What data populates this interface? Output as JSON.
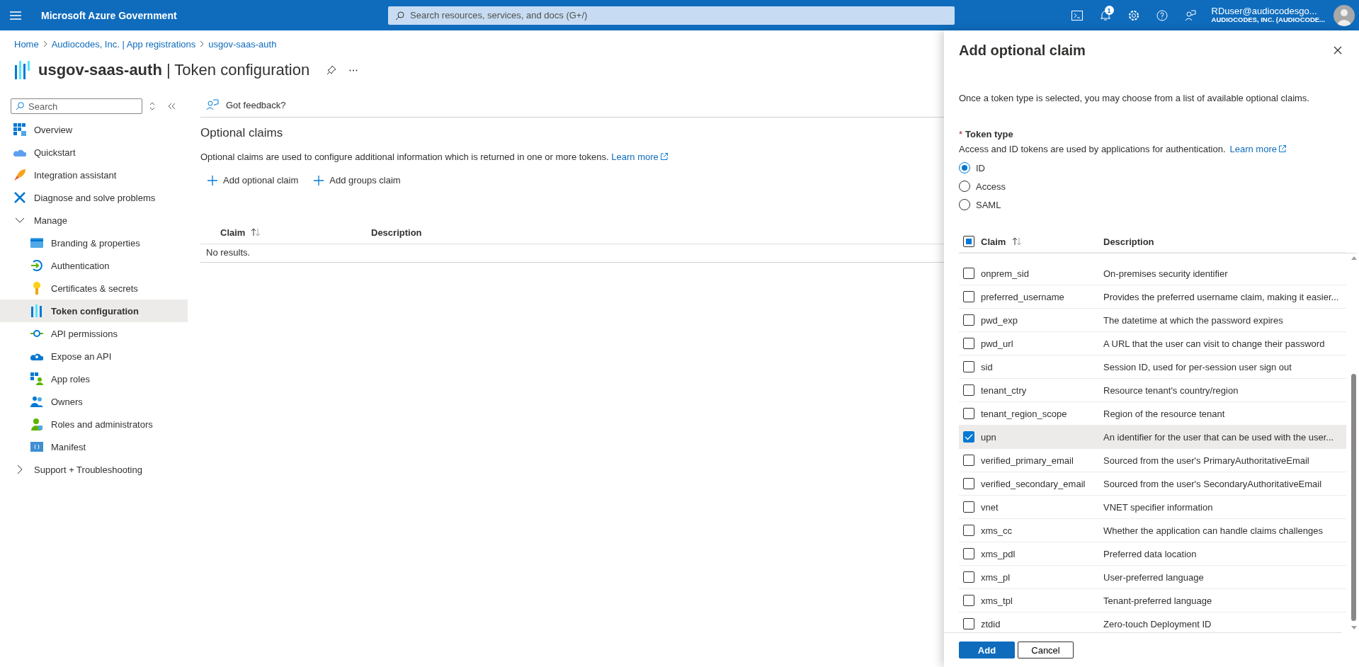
{
  "top_bar": {
    "brand": "Microsoft Azure Government",
    "search": {
      "placeholder": "Search resources, services, and docs (G+/)"
    },
    "notification_count": "1",
    "user": {
      "name": "RDuser@audiocodesgo...",
      "tenant": "AUDIOCODES, INC. (AUDIOCODE..."
    }
  },
  "breadcrumb": [
    "Home",
    "Audiocodes, Inc. | App registrations",
    "usgov-saas-auth"
  ],
  "page_title": "**usgov-saas-auth** | Token configuration",
  "sidebar": {
    "search": {
      "placeholder": "Search"
    },
    "items": [
      {
        "label": "Overview",
        "kind": "link",
        "selected": false
      },
      {
        "label": "Quickstart",
        "kind": "link",
        "selected": false
      },
      {
        "label": "Integration assistant",
        "kind": "link",
        "selected": false
      },
      {
        "label": "Diagnose and solve problems",
        "kind": "link",
        "selected": false
      },
      {
        "label": "Manage",
        "kind": "group",
        "expanded": true,
        "children": [
          {
            "label": "Branding & properties",
            "selected": false
          },
          {
            "label": "Authentication",
            "selected": false
          },
          {
            "label": "Certificates & secrets",
            "selected": false
          },
          {
            "label": "Token configuration",
            "selected": true
          },
          {
            "label": "API permissions",
            "selected": false
          },
          {
            "label": "Expose an API",
            "selected": false
          },
          {
            "label": "App roles",
            "selected": false
          },
          {
            "label": "Owners",
            "selected": false
          },
          {
            "label": "Roles and administrators",
            "selected": false
          },
          {
            "label": "Manifest",
            "selected": false
          }
        ]
      },
      {
        "label": "Support + Troubleshooting",
        "kind": "group",
        "expanded": false
      }
    ]
  },
  "content": {
    "feedback": "Got feedback?",
    "heading": "Optional claims",
    "description": "Optional claims are used to configure additional information which is returned in one or more tokens.",
    "learn_more": "Learn more",
    "actions": [
      "Add optional claim",
      "Add groups claim"
    ],
    "table": {
      "columns": [
        "Claim",
        "Description"
      ],
      "empty": "No results."
    }
  },
  "panel": {
    "title": "Add optional claim",
    "intro": "Once a token type is selected, you may choose from a list of available optional claims.",
    "token_type": {
      "label": "Token type",
      "required_mark": "*",
      "help": "Access and ID tokens are used by applications for authentication.",
      "learn_more": "Learn more",
      "options": [
        {
          "label": "ID",
          "selected": true
        },
        {
          "label": "Access",
          "selected": false
        },
        {
          "label": "SAML",
          "selected": false
        }
      ]
    },
    "claims": {
      "select_all": {
        "checked": false,
        "indeterminate": true
      },
      "columns": [
        "Claim",
        "Description"
      ],
      "rows": [
        {
          "claim": "onprem_sid",
          "description": "On-premises security identifier",
          "checked": false
        },
        {
          "claim": "preferred_username",
          "description": "Provides the preferred username claim, making it easier...",
          "checked": false
        },
        {
          "claim": "pwd_exp",
          "description": "The datetime at which the password expires",
          "checked": false
        },
        {
          "claim": "pwd_url",
          "description": "A URL that the user can visit to change their password",
          "checked": false
        },
        {
          "claim": "sid",
          "description": "Session ID, used for per-session user sign out",
          "checked": false
        },
        {
          "claim": "tenant_ctry",
          "description": "Resource tenant's country/region",
          "checked": false
        },
        {
          "claim": "tenant_region_scope",
          "description": "Region of the resource tenant",
          "checked": false
        },
        {
          "claim": "upn",
          "description": "An identifier for the user that can be used with the user...",
          "checked": true
        },
        {
          "claim": "verified_primary_email",
          "description": "Sourced from the user's PrimaryAuthoritativeEmail",
          "checked": false
        },
        {
          "claim": "verified_secondary_email",
          "description": "Sourced from the user's SecondaryAuthoritativeEmail",
          "checked": false
        },
        {
          "claim": "vnet",
          "description": "VNET specifier information",
          "checked": false
        },
        {
          "claim": "xms_cc",
          "description": "Whether the application can handle claims challenges",
          "checked": false
        },
        {
          "claim": "xms_pdl",
          "description": "Preferred data location",
          "checked": false
        },
        {
          "claim": "xms_pl",
          "description": "User-preferred language",
          "checked": false
        },
        {
          "claim": "xms_tpl",
          "description": "Tenant-preferred language",
          "checked": false
        },
        {
          "claim": "ztdid",
          "description": "Zero-touch Deployment ID",
          "checked": false
        }
      ]
    },
    "buttons": [
      "Add",
      "Cancel"
    ]
  }
}
